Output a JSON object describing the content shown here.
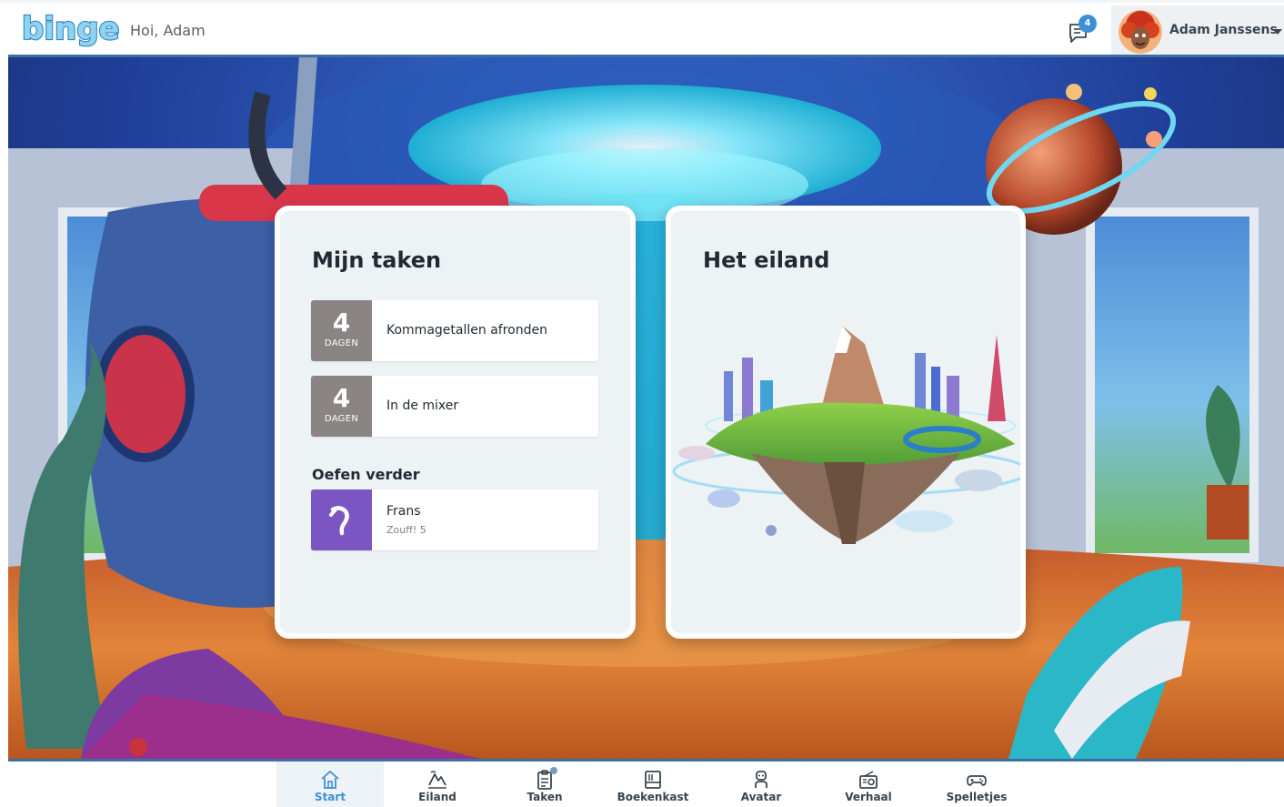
{
  "header": {
    "logo_text": "bingel",
    "greeting": "Hoi, Adam",
    "messages_badge": "4",
    "messages_icon": "messages-icon",
    "user_name": "Adam Janssens",
    "user_menu_icon": "chevron-down-icon"
  },
  "tasks_card": {
    "title": "Mijn taken",
    "tasks": [
      {
        "days": "4",
        "days_unit": "DAGEN",
        "label": "Kommagetallen afronden"
      },
      {
        "days": "4",
        "days_unit": "DAGEN",
        "label": "In de mixer"
      }
    ],
    "practice_section": "Oefen verder",
    "practice": {
      "title": "Frans",
      "subtitle": "Zouff! 5",
      "icon": "practice-icon"
    }
  },
  "island_card": {
    "title": "Het eiland"
  },
  "bottom_nav": {
    "items": [
      {
        "label": "Start",
        "icon": "home-icon",
        "active": true
      },
      {
        "label": "Eiland",
        "icon": "island-icon",
        "active": false
      },
      {
        "label": "Taken",
        "icon": "tasks-icon",
        "active": false
      },
      {
        "label": "Boekenkast",
        "icon": "bookcase-icon",
        "active": false
      },
      {
        "label": "Avatar",
        "icon": "avatar-icon",
        "active": false
      },
      {
        "label": "Verhaal",
        "icon": "radio-icon",
        "active": false
      },
      {
        "label": "Spelletjes",
        "icon": "gamepad-icon",
        "active": false
      }
    ]
  },
  "colors": {
    "accent": "#3d8fd6",
    "task_days_bg": "#8a8484",
    "practice_bg": "#7b55c2",
    "card_bg": "#edf2f4"
  }
}
